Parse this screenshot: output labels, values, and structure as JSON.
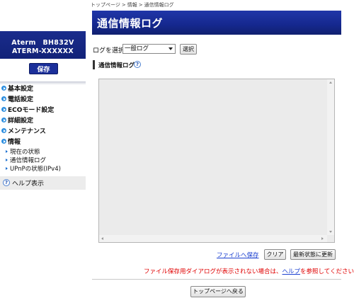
{
  "sidebar": {
    "device_name": "Aterm　BH832V",
    "device_id": "ATERM-XXXXXX",
    "save_label": "保存",
    "menu": [
      {
        "label": "基本設定"
      },
      {
        "label": "電話設定"
      },
      {
        "label": "ECOモード設定"
      },
      {
        "label": "詳細設定"
      },
      {
        "label": "メンテナンス"
      },
      {
        "label": "情報"
      }
    ],
    "submenu": [
      {
        "label": "現在の状態"
      },
      {
        "label": "通信情報ログ"
      },
      {
        "label": "UPnPの状態(IPv4)"
      }
    ],
    "help_icon_text": "?",
    "help_label": "ヘルプ表示"
  },
  "breadcrumb": {
    "items": [
      "トップページ",
      ">",
      "情報",
      ">",
      "通信情報ログ"
    ]
  },
  "header": {
    "title": "通信情報ログ"
  },
  "controls": {
    "select_label": "ログを選択",
    "select_value": "一般ログ",
    "select_button": "選択"
  },
  "section": {
    "title": "通信情報ログ",
    "help_icon_text": "?"
  },
  "actions": {
    "file_save": "ファイルへ保存",
    "clear": "クリア",
    "refresh": "最新状態に更新"
  },
  "notice": {
    "prefix": "ファイル保存用ダイアログが表示されない場合は、",
    "link": "ヘルプ",
    "suffix": "を参照してください。"
  },
  "footer": {
    "top_button": "トップページへ戻る"
  },
  "colors": {
    "brand_blue": "#1b2f9a",
    "notice_red": "#e00000",
    "link_blue": "#1a3fd0"
  }
}
